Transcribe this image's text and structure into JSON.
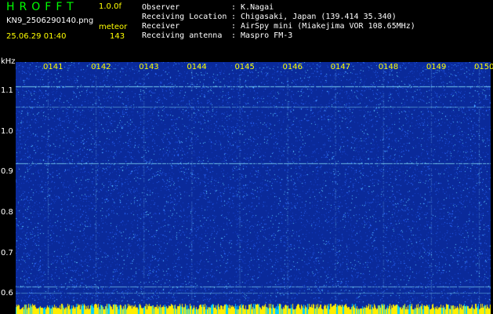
{
  "header": {
    "app_title": "HROFFT",
    "speed": "1.0.0f",
    "filename": "KN9_2506290140.png",
    "mode": "meteor",
    "datetime": "25.06.29 01:40",
    "count": "143"
  },
  "station_info": [
    {
      "key": "Observer",
      "value": ": K.Nagai"
    },
    {
      "key": "Receiving Location",
      "value": ": Chigasaki, Japan (139.414 35.340)"
    },
    {
      "key": "Receiver",
      "value": ": AirSpy mini (Miakejima VOR 108.65MHz)"
    },
    {
      "key": "Receiving antenna",
      "value": ": Maspro FM-3"
    }
  ],
  "y_axis": {
    "unit": "kHz",
    "ticks": [
      "1.1",
      "1.0",
      "0.9",
      "0.8",
      "0.7",
      "0.6"
    ],
    "range": [
      0.575,
      1.17
    ]
  },
  "x_axis": {
    "ticks": [
      "0141",
      "0142",
      "0143",
      "0144",
      "0145",
      "0146",
      "0147",
      "0148",
      "0149",
      "0150"
    ]
  },
  "colors": {
    "background": "#0a2a9a",
    "noise_dot": "#2b6bff",
    "noise_bright": "#59c8ff",
    "line": "#8ff0ff",
    "tick_label": "#ffff00",
    "bottom_strip": "#ffee00",
    "bottom_strip_alt": "#00d0ff"
  }
}
